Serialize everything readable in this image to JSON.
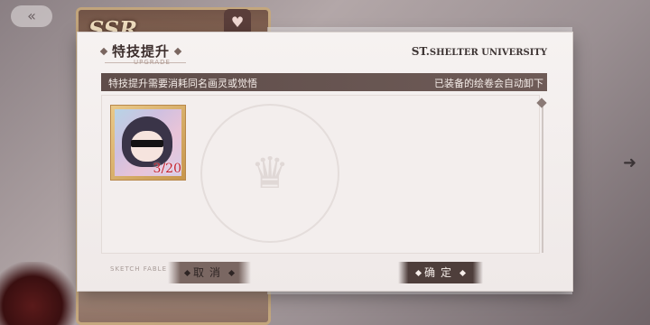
{
  "background": {
    "badge_text": "SSR",
    "back_icon": "double-chevron-left-icon",
    "heart_icon": "heart-icon",
    "arrow_icon": "arrow-right-icon"
  },
  "dialog": {
    "title": "特技提升",
    "subtitle": "UPGRADE",
    "brand_prefix": "ST.",
    "brand_name": "SHELTER UNIVERSITY",
    "info_left": "特技提升需要消耗同名画灵或觉悟",
    "info_right": "已装备的绘卷会自动卸下",
    "sketch_label": "SKETCH FABLE",
    "items": [
      {
        "count": "3/20",
        "icon": "character-portrait-icon"
      }
    ],
    "buttons": {
      "cancel": "取消",
      "confirm": "确定"
    }
  },
  "colors": {
    "title_bar": "#5f4d4a",
    "count_text": "#c4202c",
    "frame_gold": "#c7964c"
  }
}
